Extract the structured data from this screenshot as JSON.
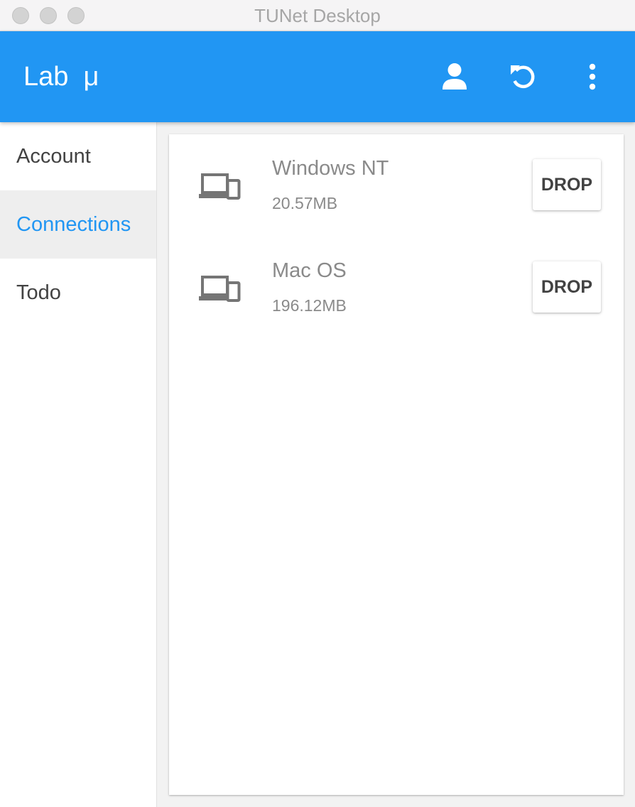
{
  "window": {
    "title": "TUNet Desktop"
  },
  "appbar": {
    "title": "Lab  μ",
    "color": "#2196f3",
    "actions": [
      {
        "icon": "account-icon"
      },
      {
        "icon": "refresh-icon"
      },
      {
        "icon": "more-vert-icon"
      }
    ]
  },
  "sidebar": {
    "items": [
      {
        "label": "Account",
        "active": false
      },
      {
        "label": "Connections",
        "active": true
      },
      {
        "label": "Todo",
        "active": false
      }
    ]
  },
  "connections": [
    {
      "name": "Windows NT",
      "usage": "20.57MB",
      "action": "DROP",
      "icon": "devices-icon"
    },
    {
      "name": "Mac OS",
      "usage": "196.12MB",
      "action": "DROP",
      "icon": "devices-icon"
    }
  ],
  "colors": {
    "accent": "#2196f3",
    "active_nav_bg": "#eeeeee",
    "text_secondary": "#8a8a8a"
  }
}
